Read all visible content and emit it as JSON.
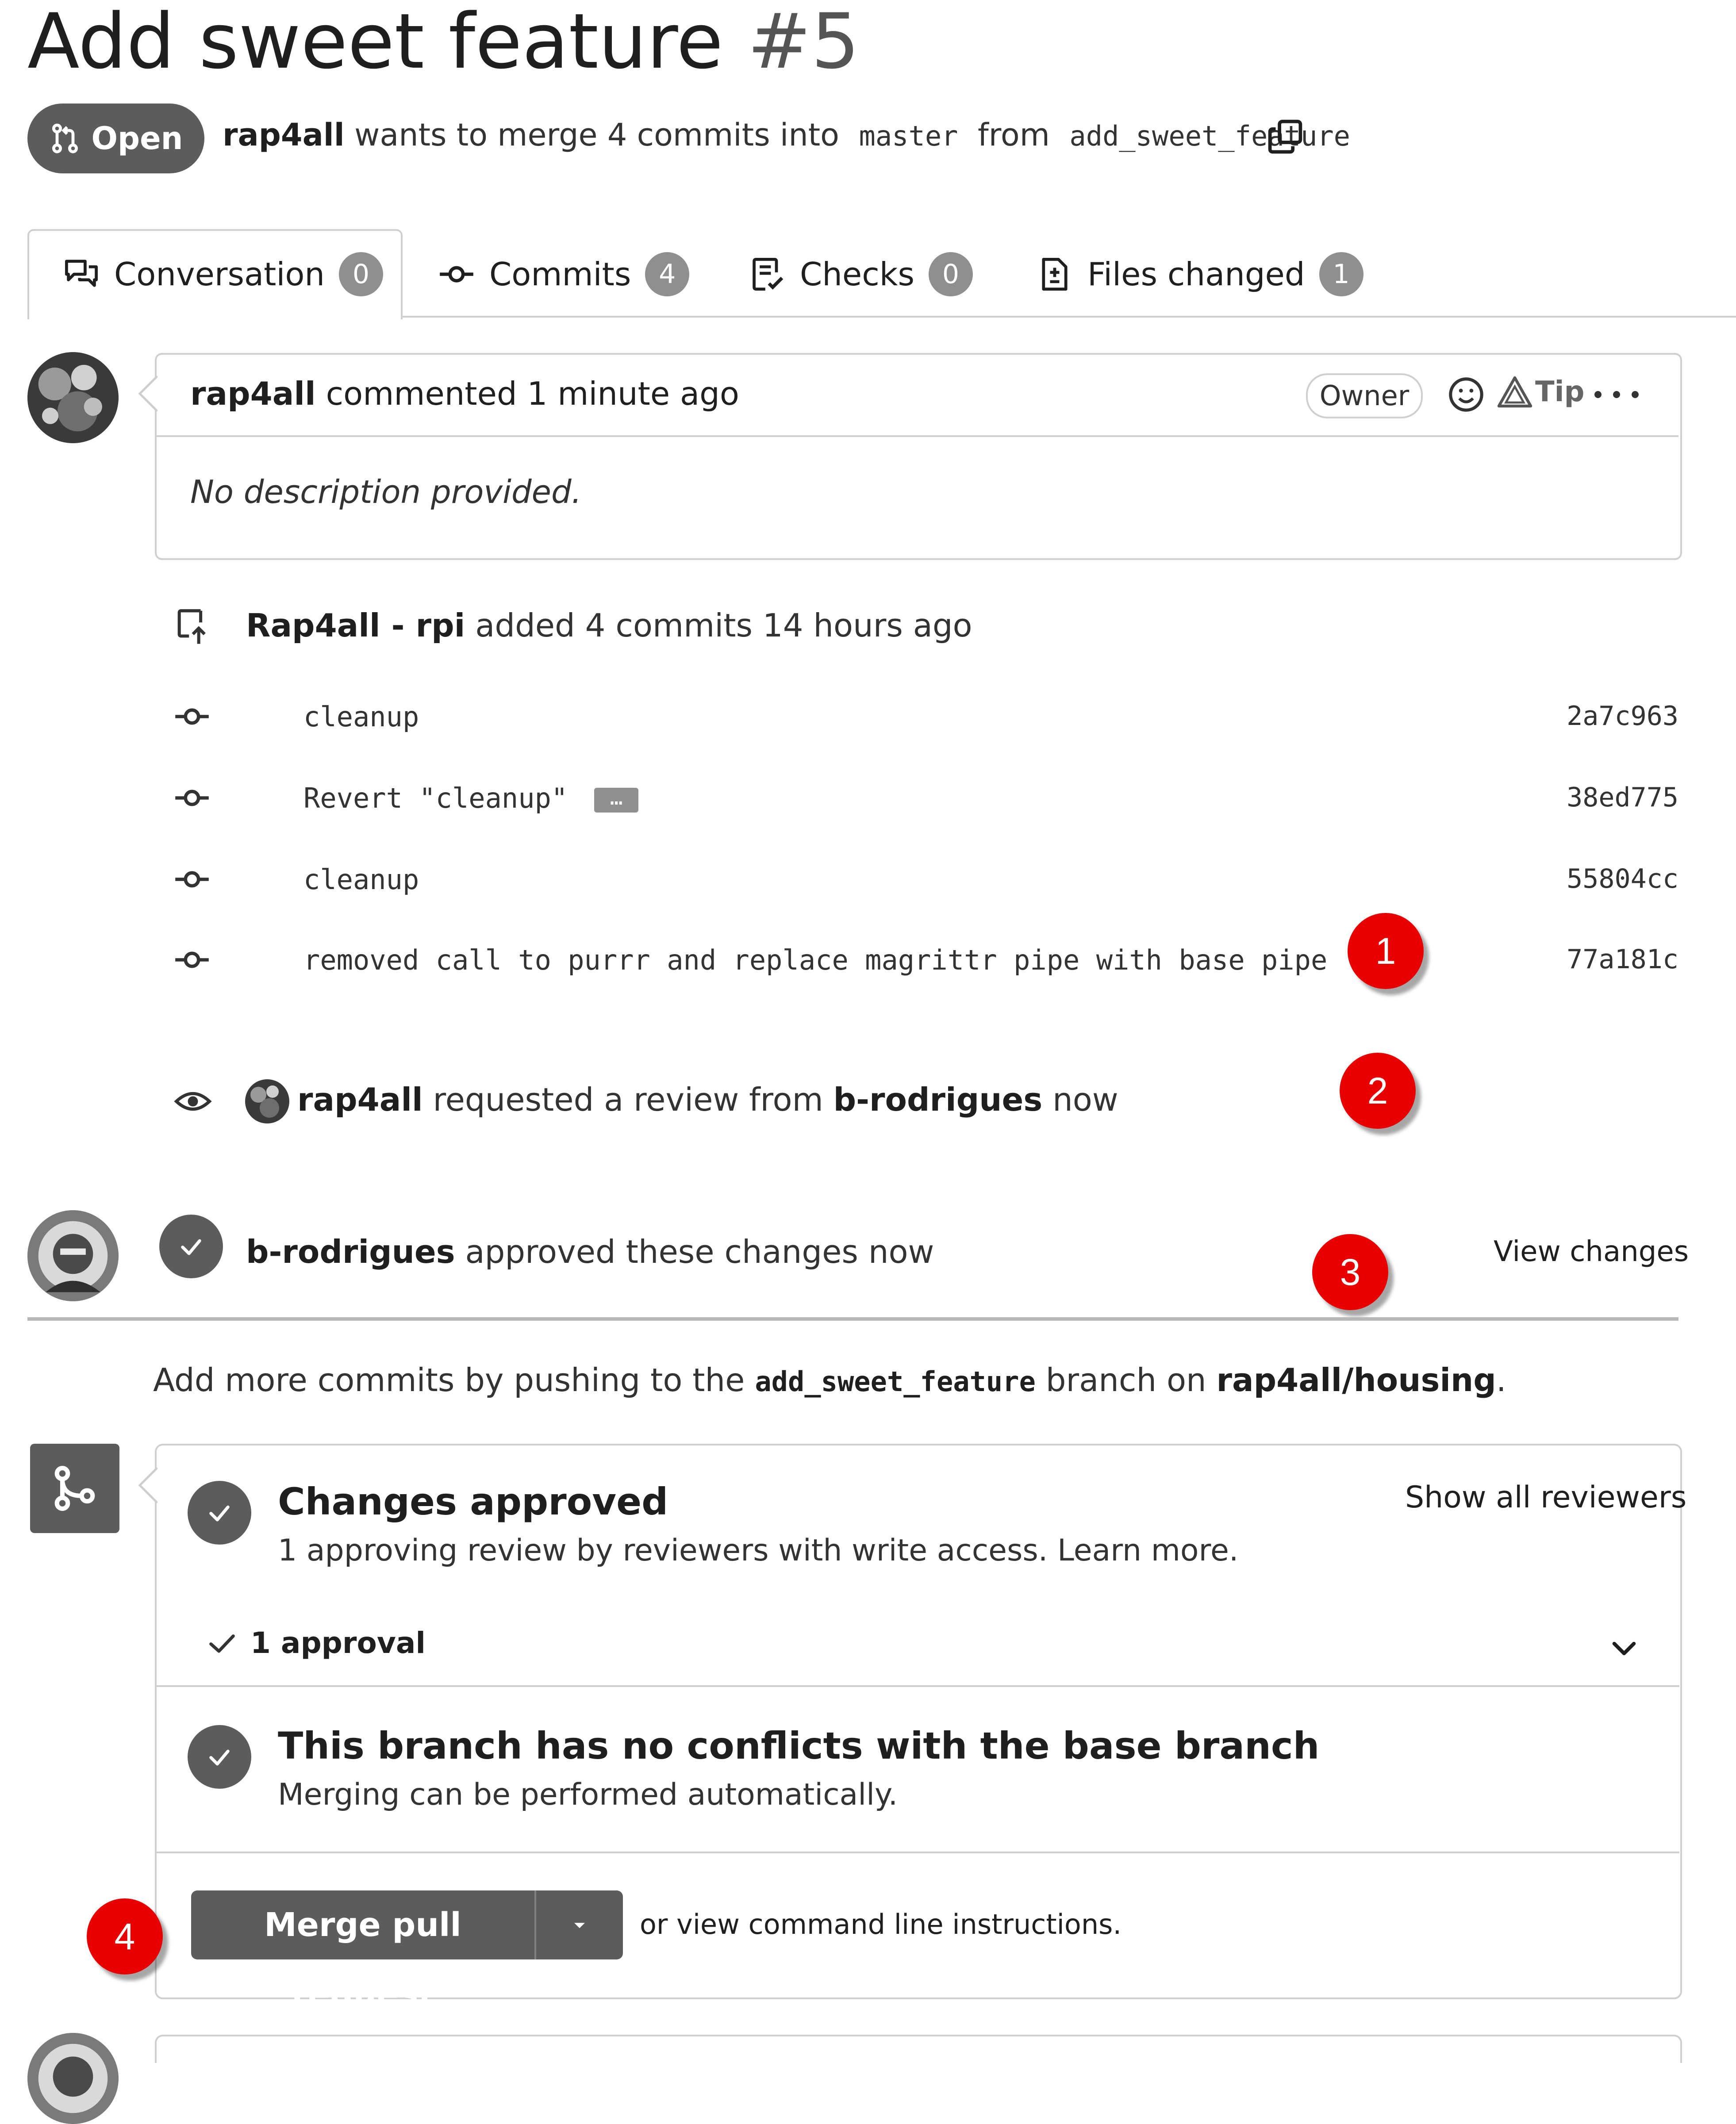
{
  "pr": {
    "title": "Add sweet feature",
    "number": "#5",
    "status": "Open",
    "author": "rap4all",
    "merge_text": "wants to merge 4 commits into",
    "base_branch": "master",
    "from_text": "from",
    "head_branch": "add_sweet_feature"
  },
  "tabs": [
    {
      "label": "Conversation",
      "count": "0",
      "icon": "comment-discussion-icon"
    },
    {
      "label": "Commits",
      "count": "4",
      "icon": "git-commit-icon"
    },
    {
      "label": "Checks",
      "count": "0",
      "icon": "checklist-icon"
    },
    {
      "label": "Files changed",
      "count": "1",
      "icon": "file-diff-icon"
    }
  ],
  "comment": {
    "author": "rap4all",
    "action": "commented 1 minute ago",
    "badge": "Owner",
    "tip_label": "Tip",
    "body": "No description provided."
  },
  "push_event": {
    "author": "Rap4all - rpi",
    "text": "added 4 commits 14 hours ago"
  },
  "commits": [
    {
      "message": "cleanup",
      "sha": "2a7c963",
      "more": ""
    },
    {
      "message": "Revert \"cleanup\"",
      "sha": "38ed775",
      "more": "…"
    },
    {
      "message": "cleanup",
      "sha": "55804cc",
      "more": ""
    },
    {
      "message": "removed call to purrr and replace magrittr pipe with base pipe",
      "sha": "77a181c",
      "more": ""
    }
  ],
  "review_request": {
    "author": "rap4all",
    "text": "requested a review from",
    "reviewer": "b-rodrigues",
    "time": "now"
  },
  "approval_event": {
    "author": "b-rodrigues",
    "text": "approved these changes now",
    "view_changes": "View changes"
  },
  "push_hint": {
    "prefix": "Add more commits by pushing to the",
    "branch": "add_sweet_feature",
    "middle": "branch on",
    "repo": "rap4all/housing",
    "suffix": "."
  },
  "merge_box": {
    "approved_title": "Changes approved",
    "approved_sub": "1 approving review by reviewers with write access. Learn more.",
    "show_reviewers": "Show all reviewers",
    "approvals": "1 approval",
    "conflicts_title": "This branch has no conflicts with the base branch",
    "conflicts_sub": "Merging can be performed automatically.",
    "merge_button": "Merge pull request",
    "cli_text": "or view command line instructions."
  },
  "markers": [
    "1",
    "2",
    "3",
    "4"
  ]
}
